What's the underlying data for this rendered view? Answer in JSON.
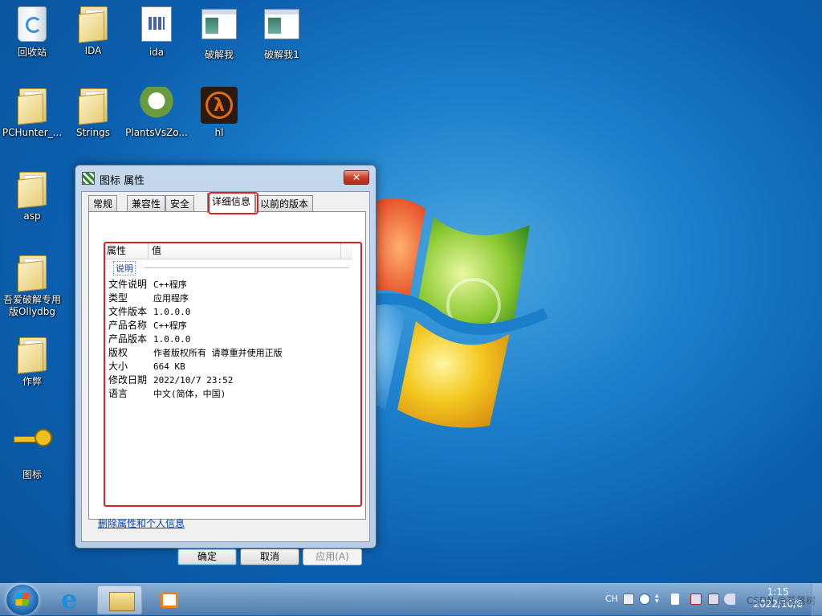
{
  "desktop": {
    "icons": [
      {
        "label": "回收站",
        "icon": "recycle-bin-icon"
      },
      {
        "label": "IDA",
        "icon": "folder-icon"
      },
      {
        "label": "ida",
        "icon": "shortcut-icon"
      },
      {
        "label": "破解我",
        "icon": "window-app-icon"
      },
      {
        "label": "破解我1",
        "icon": "window-app-icon"
      },
      {
        "label": "PCHunter_...",
        "icon": "folder-icon"
      },
      {
        "label": "Strings",
        "icon": "folder-icon"
      },
      {
        "label": "PlantsVsZo...",
        "icon": "plants-icon"
      },
      {
        "label": "hl",
        "icon": "half-life-icon"
      },
      {
        "label": "asp",
        "icon": "folder-icon"
      },
      {
        "label": "吾爱破解专用\n版Ollydbg",
        "icon": "folder-icon"
      },
      {
        "label": "作弊",
        "icon": "folder-icon"
      },
      {
        "label": "图标",
        "icon": "key-icon"
      }
    ]
  },
  "dialog": {
    "title": "图标 属性",
    "close": "✕",
    "tabs": [
      "常规",
      "兼容性",
      "安全",
      "详细信息",
      "以前的版本"
    ],
    "active_tab": "详细信息",
    "columns": [
      "属性",
      "值"
    ],
    "group": "说明",
    "rows": [
      {
        "key": "文件说明",
        "value": "C++程序"
      },
      {
        "key": "类型",
        "value": "应用程序"
      },
      {
        "key": "文件版本",
        "value": "1.0.0.0"
      },
      {
        "key": "产品名称",
        "value": "C++程序"
      },
      {
        "key": "产品版本",
        "value": "1.0.0.0"
      },
      {
        "key": "版权",
        "value": "作者版权所有 请尊重并使用正版"
      },
      {
        "key": "大小",
        "value": "664 KB"
      },
      {
        "key": "修改日期",
        "value": "2022/10/7 23:52"
      },
      {
        "key": "语言",
        "value": "中文(简体，中国)"
      }
    ],
    "remove_link": "删除属性和个人信息",
    "ok": "确定",
    "cancel": "取消",
    "apply": "应用(A)"
  },
  "taskbar": {
    "lang": "CH",
    "time": "1:15",
    "date": "2022/10/8",
    "watermark": "CSDN @花落树"
  },
  "colors": {
    "highlight": "#e02020",
    "desktop_blue": "#1c7fcb"
  }
}
